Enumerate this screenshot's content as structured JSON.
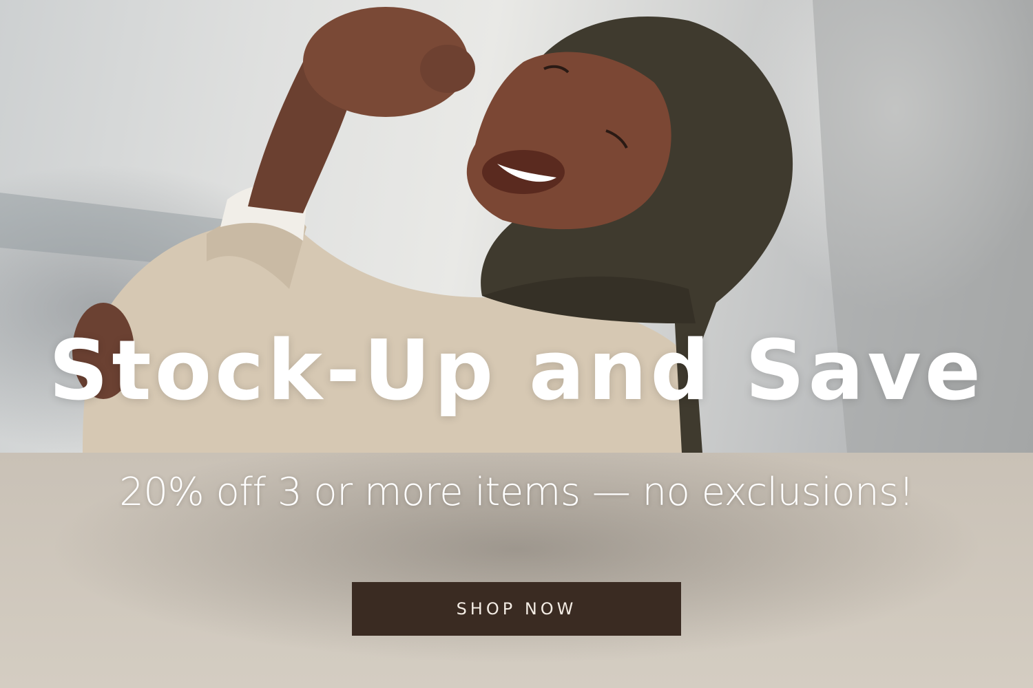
{
  "banner": {
    "headline": "Stock-Up and Save",
    "subheadline": "20% off 3 or more items — no exclusions!",
    "cta_label": "SHOP NOW"
  },
  "colors": {
    "cta_background": "#3a2b22",
    "band_background": "#d3cbbf",
    "text": "#ffffff",
    "hijab": "#3f3a2e",
    "blouse": "#d9cbb7"
  }
}
